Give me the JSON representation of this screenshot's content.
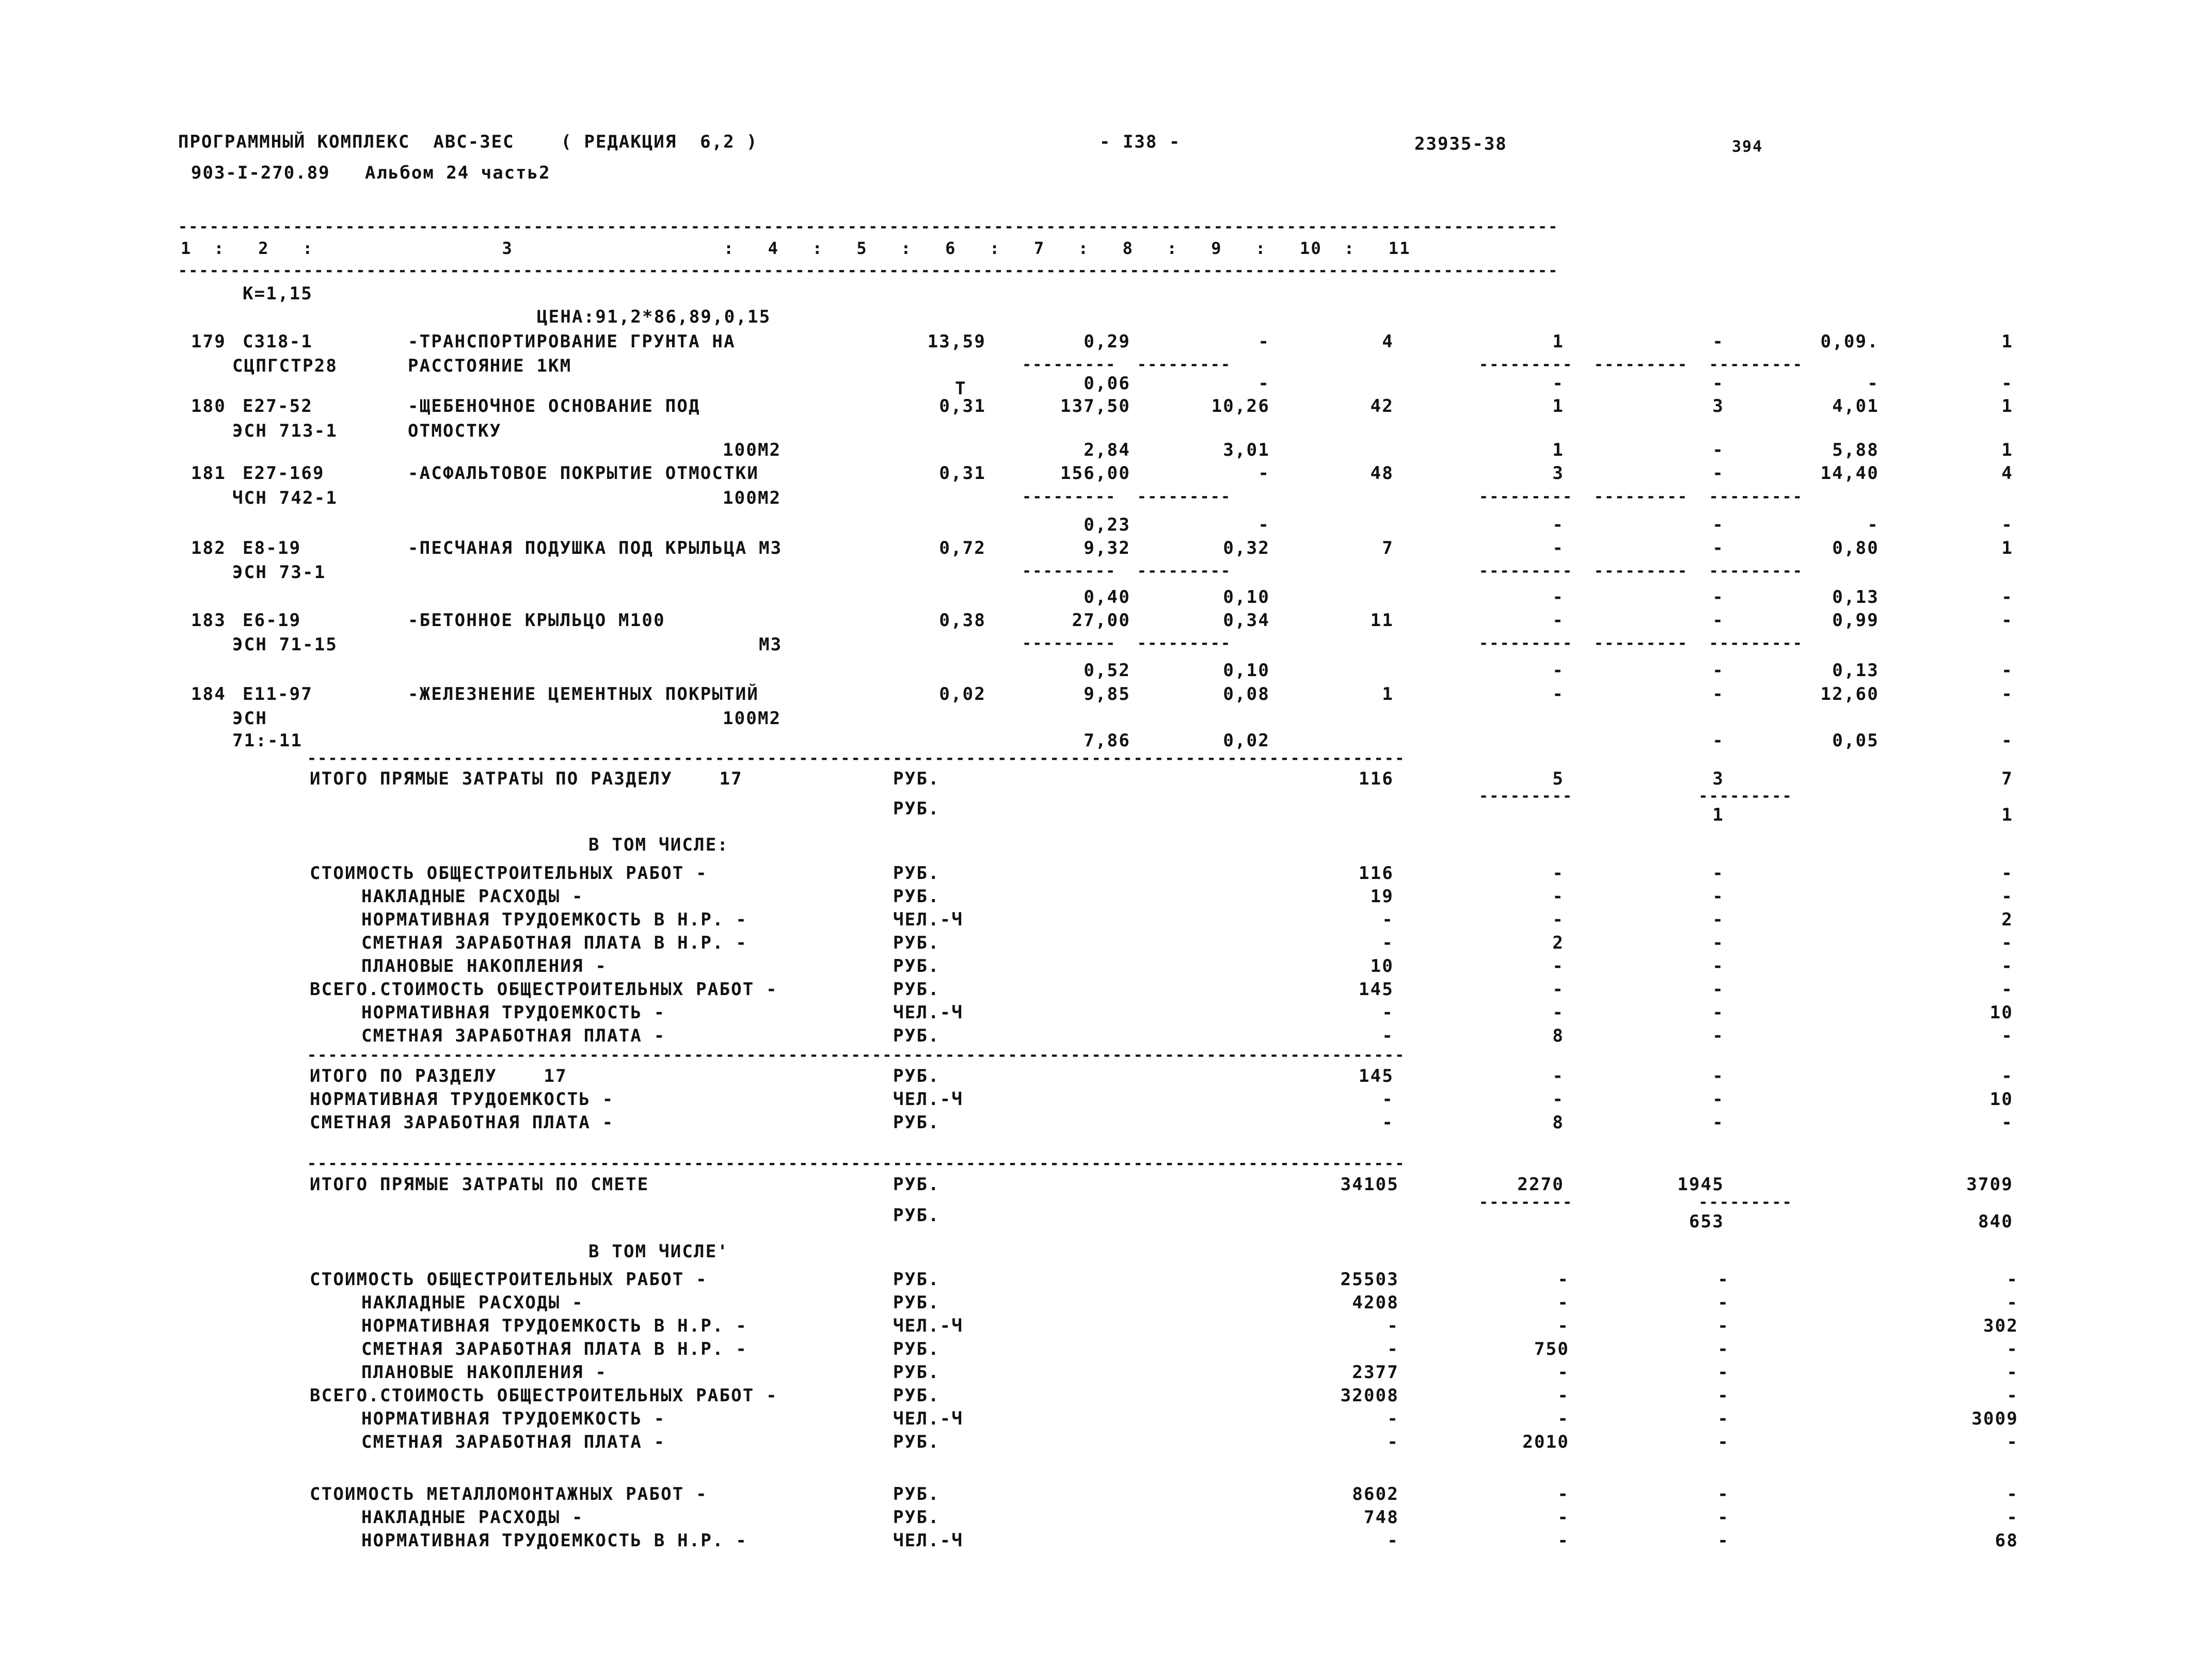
{
  "header": {
    "program_line": "ПРОГРАММНЫЙ КОМПЛЕКС  АВС-ЗЕС    ( РЕДАКЦИЯ  6,2 )",
    "album_line": "903-I-270.89   Альбом 24 часть2",
    "page_no": "- I38 -",
    "doc_no": "23935-38",
    "sheet_no": "394"
  },
  "columns": {
    "rule": "------------------------------------------------------------------------------------------------------------------------------------",
    "header_row": "1  :   2   :                 3                   :   4   :   5   :   6   :   7   :   8   :   9   :   10  :   11"
  },
  "coefficient": "К=1,15",
  "price_note": "ЦЕНА:91,2*86,89,0,15",
  "rows": [
    {
      "no": "179",
      "code": "C318-1",
      "code2": "СЦПГСТР28",
      "name1": "-ТРАНСПОРТИРОВАНИЕ ГРУНТА НА",
      "name2": "РАССТОЯНИЕ 1КМ",
      "unit": "Т",
      "c4": "13,59",
      "c5_top": "",
      "c5": "0,29",
      "c6_top": "",
      "c6": "-",
      "c7": "4",
      "c8_top": "",
      "c8": "1",
      "c9_top": "",
      "c9": "-",
      "c10_top": "",
      "c10": "0,09.",
      "c11_top": "",
      "c11": "1"
    },
    {
      "no": "180",
      "code": "Е27-52",
      "code2": "ЭСН 713-1",
      "name1": "-ЩЕБЕНОЧНОЕ ОСНОВАНИЕ ПОД",
      "name2": "ОТМОСТКУ",
      "unit": "",
      "c4": "0,31",
      "c5_top": "0,06",
      "c5": "137,50",
      "c6_top": "-",
      "c6": "10,26",
      "c7": "42",
      "c8_top": "-",
      "c8": "1",
      "c9_top": "-",
      "c9": "3",
      "c10_top": "-",
      "c10": "4,01",
      "c11_top": "-",
      "c11": "1"
    },
    {
      "no": "181",
      "code": "Е27-169",
      "code2": "ЧСН 742-1",
      "name1": "-АСФАЛЬТОВОЕ ПОКРЫТИЕ ОТМОСТКИ",
      "name2": "100М2",
      "unit": "100М2",
      "c4": "0,31",
      "c5_top": "2,84",
      "c5": "156,00",
      "c6_top": "3,01",
      "c6": "-",
      "c7": "48",
      "c8_top": "1",
      "c8": "3",
      "c9_top": "-",
      "c9": "-",
      "c10_top": "5,88",
      "c10": "14,40",
      "c11_top": "1",
      "c11": "4"
    },
    {
      "no": "182",
      "code": "Е8-19",
      "code2": "ЭСН 73-1",
      "name1": "-ПЕСЧАНАЯ ПОДУШКА ПОД КРЫЛЬЦА",
      "name2": "М3",
      "unit": "М3",
      "c4": "0,72",
      "c5_top": "0,23",
      "c5": "9,32",
      "c6_top": "-",
      "c6": "0,32",
      "c7": "7",
      "c8_top": "-",
      "c8": "-",
      "c9_top": "-",
      "c9": "-",
      "c10_top": "-",
      "c10": "0,80",
      "c11_top": "-",
      "c11": "1"
    },
    {
      "no": "183",
      "code": "Е6-19",
      "code2": "ЭСН 71-15",
      "name1": "-БЕТОННОЕ КРЫЛЬЦО М100",
      "name2": "М3",
      "unit": "М3",
      "c4": "0,38",
      "c5_top": "0,40",
      "c5": "27,00",
      "c6_top": "0,10",
      "c6": "0,34",
      "c7": "11",
      "c8_top": "-",
      "c8": "-",
      "c9_top": "-",
      "c9": "-",
      "c10_top": "0,13",
      "c10": "0,99",
      "c11_top": "-",
      "c11": "-"
    },
    {
      "no": "184",
      "code": "Е11-97",
      "code2": "ЭСН",
      "code3": "71:-11",
      "name1": "-ЖЕЛЕЗНЕНИЕ ЦЕМЕНТНЫХ ПОКРЫТИЙ",
      "name2": "100М2",
      "unit": "100М2",
      "c4": "0,02",
      "c5_top": "0,52",
      "c5": "9,85",
      "c6_top": "0,10",
      "c6": "0,08",
      "c7": "1",
      "c8_top": "-",
      "c8": "-",
      "c9_top": "-",
      "c9": "-",
      "c10_top": "0,13",
      "c10": "12,60",
      "c11_top": "-",
      "c11": "-"
    }
  ],
  "row184_extra": {
    "c5": "7,86",
    "c6": "0,02",
    "c9": "-",
    "c10": "0,05",
    "c11": "-"
  },
  "section17": {
    "total_direct_label": "ИТОГО ПРЯМЫЕ ЗАТРАТЫ ПО РАЗДЕЛУ    17",
    "total_direct_unit": "РУБ.",
    "total_direct_c7": "116",
    "total_direct_c8": "5",
    "total_direct_c9": "3",
    "total_direct_c11": "7",
    "sub_unit": "РУБ.",
    "sub_c9": "1",
    "sub_c11": "1",
    "among_label": "В ТОМ ЧИСЛЕ:",
    "items": [
      {
        "label": "СТОИМОСТЬ ОБЩЕСТРОИТЕЛЬНЫХ РАБОТ -",
        "indent": 0,
        "unit": "РУБ.",
        "c7": "116",
        "c8": "-",
        "c9": "-",
        "c11": "-"
      },
      {
        "label": "НАКЛАДНЫЕ РАСХОДЫ -",
        "indent": 1,
        "unit": "РУБ.",
        "c7": "19",
        "c8": "-",
        "c9": "-",
        "c11": "-"
      },
      {
        "label": "НОРМАТИВНАЯ ТРУДОЕМКОСТЬ В Н.Р. -",
        "indent": 1,
        "unit": "ЧЕЛ.-Ч",
        "c7": "-",
        "c8": "-",
        "c9": "-",
        "c11": "2"
      },
      {
        "label": "СМЕТНАЯ ЗАРАБОТНАЯ ПЛАТА В Н.Р. -",
        "indent": 1,
        "unit": "РУБ.",
        "c7": "-",
        "c8": "2",
        "c9": "-",
        "c11": "-"
      },
      {
        "label": "ПЛАНОВЫЕ НАКОПЛЕНИЯ -",
        "indent": 1,
        "unit": "РУБ.",
        "c7": "10",
        "c8": "-",
        "c9": "-",
        "c11": "-"
      },
      {
        "label": "ВСЕГО.СТОИМОСТЬ ОБЩЕСТРОИТЕЛЬНЫХ РАБОТ -",
        "indent": 0,
        "unit": "РУБ.",
        "c7": "145",
        "c8": "-",
        "c9": "-",
        "c11": "-"
      },
      {
        "label": "НОРМАТИВНАЯ ТРУДОЕМКОСТЬ -",
        "indent": 1,
        "unit": "ЧЕЛ.-Ч",
        "c7": "-",
        "c8": "-",
        "c9": "-",
        "c11": "10"
      },
      {
        "label": "СМЕТНАЯ ЗАРАБОТНАЯ ПЛАТА -",
        "indent": 1,
        "unit": "РУБ.",
        "c7": "-",
        "c8": "8",
        "c9": "-",
        "c11": "-"
      }
    ],
    "totals": [
      {
        "label": "ИТОГО ПО РАЗДЕЛУ    17",
        "indent": 0,
        "unit": "РУБ.",
        "c7": "145",
        "c8": "-",
        "c9": "-",
        "c11": "-"
      },
      {
        "label": "НОРМАТИВНАЯ ТРУДОЕМКОСТЬ -",
        "indent": 0,
        "unit": "ЧЕЛ.-Ч",
        "c7": "-",
        "c8": "-",
        "c9": "-",
        "c11": "10"
      },
      {
        "label": "СМЕТНАЯ ЗАРАБОТНАЯ ПЛАТА -",
        "indent": 0,
        "unit": "РУБ.",
        "c7": "-",
        "c8": "8",
        "c9": "-",
        "c11": "-"
      }
    ]
  },
  "estimate": {
    "total_direct_label": "ИТОГО ПРЯМЫЕ ЗАТРАТЫ ПО СМЕТЕ",
    "total_direct_unit": "РУБ.",
    "total_direct_c7": "34105",
    "total_direct_c8": "2270",
    "total_direct_c9": "1945",
    "total_direct_c11": "3709",
    "sub_unit": "РУБ.",
    "sub_c9": "653",
    "sub_c11": "840",
    "among_label": "В ТОМ ЧИСЛЕ'",
    "items": [
      {
        "label": "СТОИМОСТЬ ОБЩЕСТРОИТЕЛЬНЫХ РАБОТ -",
        "indent": 0,
        "unit": "РУБ.",
        "c7": "25503",
        "c8": "-",
        "c9": "-",
        "c11": "-"
      },
      {
        "label": "НАКЛАДНЫЕ РАСХОДЫ -",
        "indent": 1,
        "unit": "РУБ.",
        "c7": "4208",
        "c8": "-",
        "c9": "-",
        "c11": "-"
      },
      {
        "label": "НОРМАТИВНАЯ ТРУДОЕМКОСТЬ В Н.Р. -",
        "indent": 1,
        "unit": "ЧЕЛ.-Ч",
        "c7": "-",
        "c8": "-",
        "c9": "-",
        "c11": "302"
      },
      {
        "label": "СМЕТНАЯ ЗАРАБОТНАЯ ПЛАТА В Н.Р. -",
        "indent": 1,
        "unit": "РУБ.",
        "c7": "-",
        "c8": "750",
        "c9": "-",
        "c11": "-"
      },
      {
        "label": "ПЛАНОВЫЕ НАКОПЛЕНИЯ -",
        "indent": 1,
        "unit": "РУБ.",
        "c7": "2377",
        "c8": "-",
        "c9": "-",
        "c11": "-"
      },
      {
        "label": "ВСЕГО.СТОИМОСТЬ ОБЩЕСТРОИТЕЛЬНЫХ РАБОТ -",
        "indent": 0,
        "unit": "РУБ.",
        "c7": "32008",
        "c8": "-",
        "c9": "-",
        "c11": "-"
      },
      {
        "label": "НОРМАТИВНАЯ ТРУДОЕМКОСТЬ -",
        "indent": 1,
        "unit": "ЧЕЛ.-Ч",
        "c7": "-",
        "c8": "-",
        "c9": "-",
        "c11": "3009"
      },
      {
        "label": "СМЕТНАЯ ЗАРАБОТНАЯ ПЛАТА -",
        "indent": 1,
        "unit": "РУБ.",
        "c7": "-",
        "c8": "2010",
        "c9": "-",
        "c11": "-"
      }
    ],
    "metal": [
      {
        "label": "СТОИМОСТЬ МЕТАЛЛОМОНТАЖНЫХ РАБОТ -",
        "indent": 0,
        "unit": "РУБ.",
        "c7": "8602",
        "c8": "-",
        "c9": "-",
        "c11": "-"
      },
      {
        "label": "НАКЛАДНЫЕ РАСХОДЫ -",
        "indent": 1,
        "unit": "РУБ.",
        "c7": "748",
        "c8": "-",
        "c9": "-",
        "c11": "-"
      },
      {
        "label": "НОРМАТИВНАЯ ТРУДОЕМКОСТЬ В Н.Р. -",
        "indent": 1,
        "unit": "ЧЕЛ.-Ч",
        "c7": "-",
        "c8": "-",
        "c9": "-",
        "c11": "68"
      }
    ]
  }
}
